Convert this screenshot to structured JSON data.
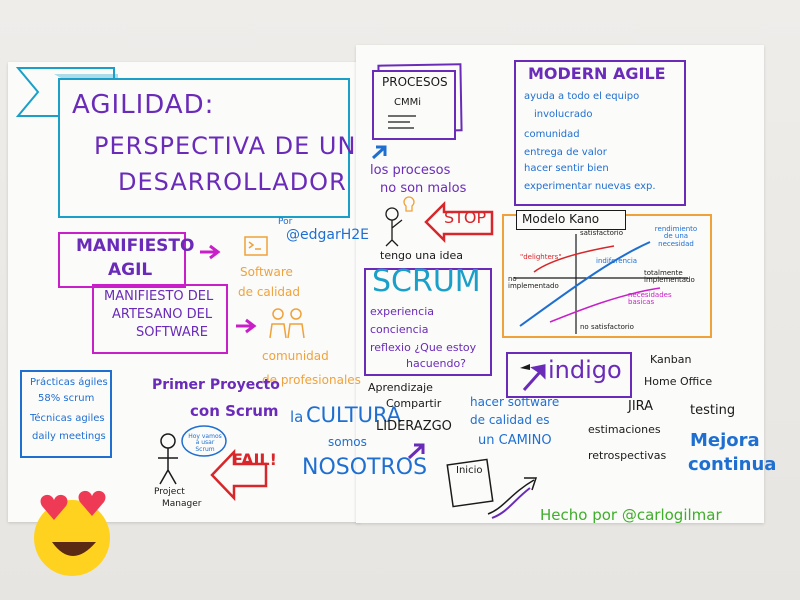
{
  "title": {
    "line1": "AGILIDAD:",
    "line2": "PERSPECTIVA DE UN",
    "line3": "DESARROLLADOR"
  },
  "byline": {
    "prefix": "Por",
    "handle": "@edgarH2E"
  },
  "manifiesto_agil": {
    "line1": "MANIFIESTO",
    "line2": "AGIL"
  },
  "manifiesto_artesano": {
    "line1": "MANIFIESTO DEL",
    "line2": "ARTESANO DEL",
    "line3": "SOFTWARE"
  },
  "software_calidad": {
    "line1": "Software",
    "line2": "de calidad"
  },
  "comunidad": {
    "line1": "comunidad",
    "line2": "de profesionales"
  },
  "practicas": {
    "line1": "Prácticas ágiles",
    "line2": "58% scrum",
    "line3": "Técnicas agiles",
    "line4": "daily meetings"
  },
  "primer_proyecto": {
    "line1": "Primer Proyecto",
    "line2": "con Scrum"
  },
  "speech": {
    "text": "Hoy vamos a usar Scrum"
  },
  "project_manager": {
    "line1": "Project",
    "line2": "Manager"
  },
  "fail": "FAIL!",
  "cultura": {
    "line1a": "la",
    "line1b": "CULTURA",
    "line2": "somos",
    "line3": "NOSOTROS"
  },
  "procesos": {
    "title": "PROCESOS",
    "sub": "CMMi"
  },
  "procesos_note": {
    "line1": "los procesos",
    "line2": "no son malos"
  },
  "stop": "STOP",
  "idea": "tengo una idea",
  "scrum": {
    "title": "SCRUM",
    "items": [
      "experiencia",
      "conciencia",
      "reflexio ¿Que estoy",
      "hacuendo?"
    ]
  },
  "aprendizaje": {
    "line1": "Aprendizaje",
    "line2": "Compartir",
    "line3": "LIDERAZGO"
  },
  "hacer_software": {
    "line1": "hacer software",
    "line2": "de calidad es",
    "line3": "un CAMINO"
  },
  "inicio": "Inicio",
  "modern_agile": {
    "title": "MODERN AGILE",
    "items": [
      "ayuda a todo el equipo",
      "involucrado",
      "comunidad",
      "entrega de valor",
      "hacer sentir bien",
      "experimentar nuevas exp."
    ]
  },
  "kano": {
    "title": "Modelo Kano",
    "top": "satisfactorio",
    "bottom": "no satisfactorio",
    "left": "no implementado",
    "right": "totalmente implementado",
    "delighters": "\"delighters\"",
    "indiferencia": "indiferencia",
    "rendimiento": "rendimiento de una necesidad",
    "basicas": "necesidades basicas"
  },
  "indigo": "indigo",
  "tools": [
    "Kanban",
    "Home Office",
    "JIRA",
    "testing",
    "estimaciones",
    "retrospectivas"
  ],
  "mejora": {
    "line1": "Mejora",
    "line2": "continua"
  },
  "hecho_por": "Hecho por @carlogilmar",
  "colors": {
    "purple": "#6a2bb8",
    "blue": "#1f6fd1",
    "magenta": "#c81fc8",
    "orange": "#f0a23a",
    "red": "#d8262a",
    "green": "#3fae2a",
    "black": "#1a1a1a",
    "teal": "#1aa0c8"
  },
  "emoji": "heart-eyes-emoji"
}
